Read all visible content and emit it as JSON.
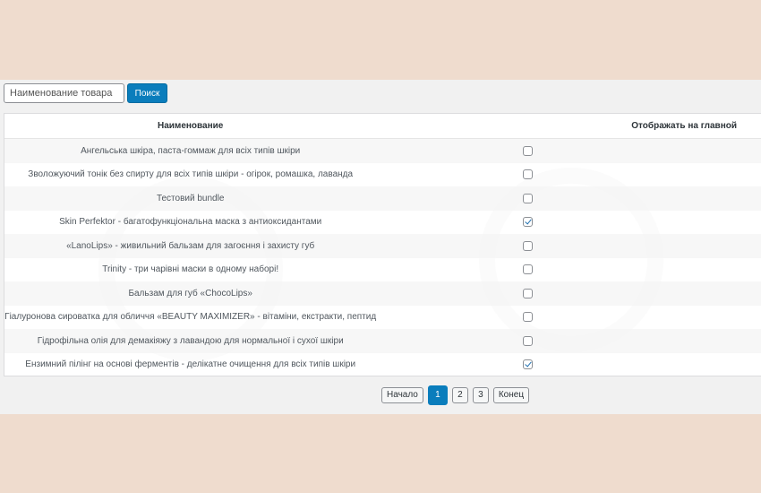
{
  "search": {
    "placeholder": "Наименование товара",
    "button_label": "Поиск"
  },
  "table": {
    "headers": {
      "name": "Наименование",
      "show_on_main": "Отображать на главной"
    },
    "rows": [
      {
        "name": "Ангельська шкіра, паста-гоммаж для всіх типів шкіри",
        "checked": false
      },
      {
        "name": "Зволожуючий тонік без спирту для всіх типів шкіри - огірок, ромашка, лаванда",
        "checked": false
      },
      {
        "name": "Тестовий bundle",
        "checked": false
      },
      {
        "name": "Skin Perfektor - багатофункціональна маска з антиоксидантами",
        "checked": true
      },
      {
        "name": "«LanoLips» - живильний бальзам для загоєння і захисту губ",
        "checked": false
      },
      {
        "name": "Trinity - три чарівні маски в одному наборі!",
        "checked": false
      },
      {
        "name": "Бальзам для губ «ChocoLips»",
        "checked": false
      },
      {
        "name": "Гіалуронова сироватка для обличчя «BEAUTY MAXIMIZER» - вітаміни, екстракти, пептид",
        "checked": false
      },
      {
        "name": "Гідрофільна олія для демакіяжу з лавандою для нормальної і сухої шкіри",
        "checked": false
      },
      {
        "name": "Ензимний пілінг на основі ферментів - делікатне очищення для всіх типів шкіри",
        "checked": true
      }
    ]
  },
  "pagination": {
    "first_label": "Начало",
    "pages": [
      "1",
      "2",
      "3"
    ],
    "current": "1",
    "last_label": "Конец"
  },
  "colors": {
    "background": "#efdcce",
    "accent": "#0a7dbc"
  }
}
